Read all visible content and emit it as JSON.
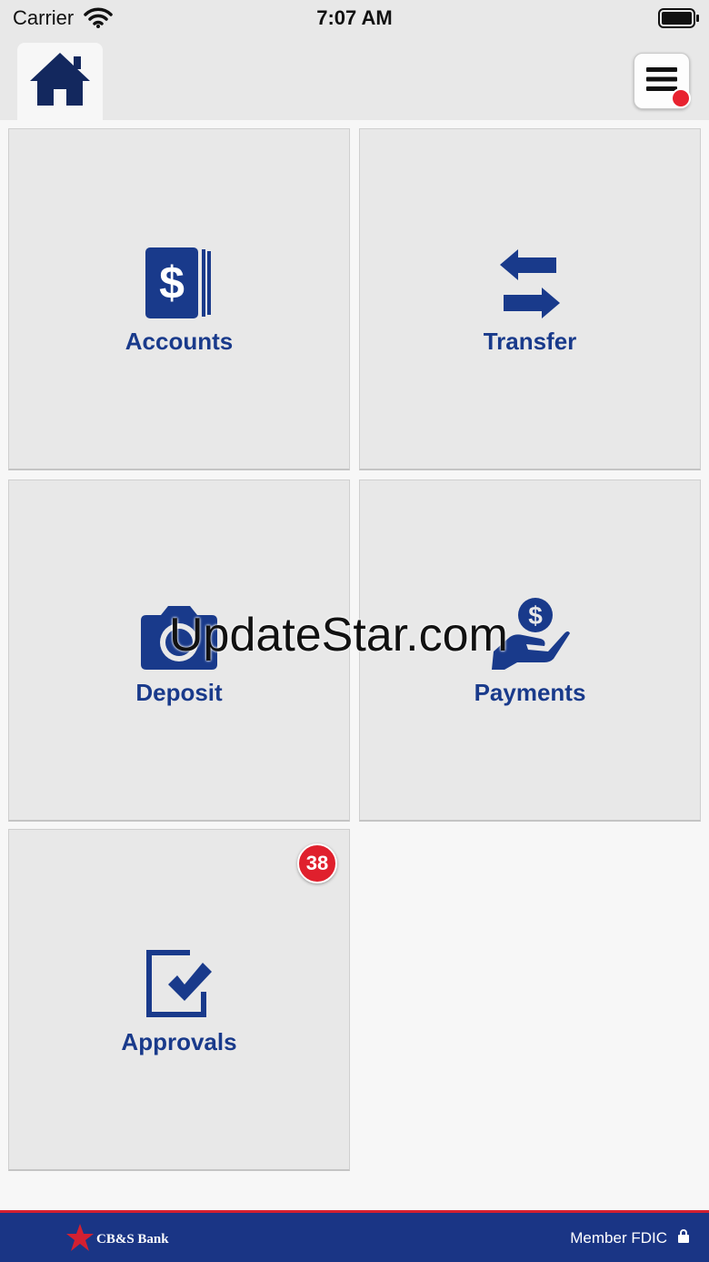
{
  "status_bar": {
    "carrier": "Carrier",
    "time": "7:07 AM",
    "icons": [
      "wifi-icon",
      "battery-icon"
    ]
  },
  "header": {
    "home_icon": "home-icon",
    "menu_icon": "hamburger-menu-icon",
    "menu_has_notification": true
  },
  "tiles": [
    {
      "label": "Accounts",
      "icon": "dollar-card-icon"
    },
    {
      "label": "Transfer",
      "icon": "transfer-arrows-icon"
    },
    {
      "label": "Deposit",
      "icon": "camera-icon"
    },
    {
      "label": "Payments",
      "icon": "hand-coin-icon"
    },
    {
      "label": "Approvals",
      "icon": "approval-check-icon",
      "badge": "38"
    }
  ],
  "watermark": "UpdateStar.com",
  "footer": {
    "brand": "CB&S Bank",
    "member": "Member FDIC"
  },
  "colors": {
    "brand_blue": "#193a8b",
    "footer_blue": "#1a3585",
    "badge_red": "#e0202d",
    "tile_bg": "#e8e8e8"
  }
}
